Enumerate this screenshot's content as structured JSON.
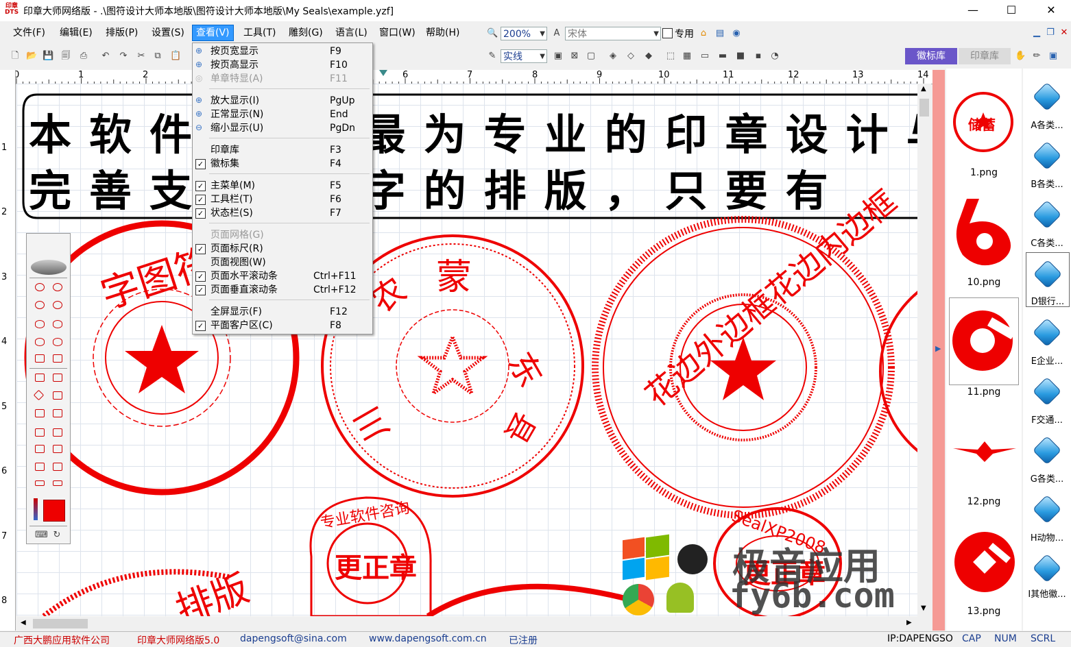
{
  "window": {
    "logo_text": "印章\nDTS",
    "title": "印章大师网络版 -                                        .\\图符设计大师本地版\\图符设计大师本地版\\My Seals\\example.yzf]",
    "minimize": "—",
    "maximize": "☐",
    "close": "✕"
  },
  "menubar": [
    "文件(F)",
    "编辑(E)",
    "排版(P)",
    "设置(S)",
    "查看(V)",
    "工具(T)",
    "雕刻(G)",
    "语言(L)",
    "窗口(W)",
    "帮助(H)"
  ],
  "toolbar": {
    "zoom": "200%",
    "font": "宋体",
    "special_label": "专用",
    "line_style": "实线",
    "tab_emblems": "徽标库",
    "tab_seals": "印章库"
  },
  "view_menu": [
    {
      "label": "按页宽显示",
      "key": "F9",
      "icon": "fit-width-icon",
      "enabled": true
    },
    {
      "label": "按页高显示",
      "key": "F10",
      "icon": "fit-height-icon",
      "enabled": true
    },
    {
      "label": "单章特显(A)",
      "key": "F11",
      "icon": "single-seal-icon",
      "enabled": false
    },
    {
      "label": "放大显示(I)",
      "key": "PgUp",
      "icon": "zoom-in-icon",
      "enabled": true
    },
    {
      "label": "正常显示(N)",
      "key": "End",
      "icon": "zoom-normal-icon",
      "enabled": true
    },
    {
      "label": "缩小显示(U)",
      "key": "PgDn",
      "icon": "zoom-out-icon",
      "enabled": true
    },
    {
      "label": "印章库",
      "key": "F3",
      "checked": false,
      "enabled": true
    },
    {
      "label": "徽标集",
      "key": "F4",
      "checked": true,
      "enabled": true
    },
    {
      "label": "主菜单(M)",
      "key": "F5",
      "checked": true,
      "enabled": true
    },
    {
      "label": "工具栏(T)",
      "key": "F6",
      "checked": true,
      "enabled": true
    },
    {
      "label": "状态栏(S)",
      "key": "F7",
      "checked": true,
      "enabled": true
    },
    {
      "label": "页面网格(G)",
      "key": "",
      "checked": false,
      "enabled": false
    },
    {
      "label": "页面标尺(R)",
      "key": "",
      "checked": true,
      "enabled": true
    },
    {
      "label": "页面视图(W)",
      "key": "",
      "checked": false,
      "enabled": true
    },
    {
      "label": "页面水平滚动条",
      "key": "Ctrl+F11",
      "checked": true,
      "enabled": true
    },
    {
      "label": "页面垂直滚动条",
      "key": "Ctrl+F12",
      "checked": true,
      "enabled": true
    },
    {
      "label": "全屏显示(F)",
      "key": "F12",
      "checked": false,
      "enabled": true
    },
    {
      "label": "平面客户区(C)",
      "key": "F8",
      "checked": true,
      "enabled": true
    }
  ],
  "ruler": {
    "h_labels": [
      "0",
      "1",
      "2",
      "3",
      "4",
      "5",
      "6",
      "7",
      "8",
      "9",
      "10",
      "11",
      "12",
      "13",
      "14"
    ],
    "v_labels": [
      "1",
      "2",
      "3",
      "4",
      "5",
      "6",
      "7",
      "8"
    ]
  },
  "canvas": {
    "banner_line1": "本软件是          止最为专业的印章设计与",
    "banner_line2": "完善支          言文字的排版，只要有",
    "seal1_text": "字图符",
    "seal2_top": "蒙",
    "seal2_left": "农",
    "seal2_right": "东",
    "seal2_bottom": "川",
    "seal2_bottomright": "县",
    "seal3_text": "花边外边框花边内边框",
    "seal4_center": "更正章",
    "seal4_ring": "专业软件咨询",
    "seal5_center": "更正章",
    "seal5_ring": "SealXP2008",
    "seal6_text": "排版",
    "watermark_top": "极音应用",
    "watermark_bottom": "fy6b.com"
  },
  "seal_library": [
    {
      "name": "1.png",
      "glyph": "储蓄"
    },
    {
      "name": "10.png",
      "glyph": ""
    },
    {
      "name": "11.png",
      "glyph": ""
    },
    {
      "name": "12.png",
      "glyph": ""
    },
    {
      "name": "13.png",
      "glyph": ""
    }
  ],
  "categories": [
    "A各类...",
    "B各类...",
    "C各类...",
    "D银行...",
    "E企业...",
    "F交通...",
    "G各类...",
    "H动物...",
    "I其他徽..."
  ],
  "statusbar": {
    "company": "广西大鹏应用软件公司",
    "product": "印章大师网络版5.0",
    "email": "dapengsoft@sina.com",
    "website": "www.dapengsoft.com.cn",
    "registered": "已注册",
    "ip": "IP:DAPENGSO",
    "cap": "CAP",
    "num": "NUM",
    "scrl": "SCRL"
  },
  "colors": {
    "seal_red": "#ee0000",
    "menu_highlight": "#3399ff",
    "panel_pink": "#f59a95",
    "cat_blue": "#2a9be0"
  }
}
